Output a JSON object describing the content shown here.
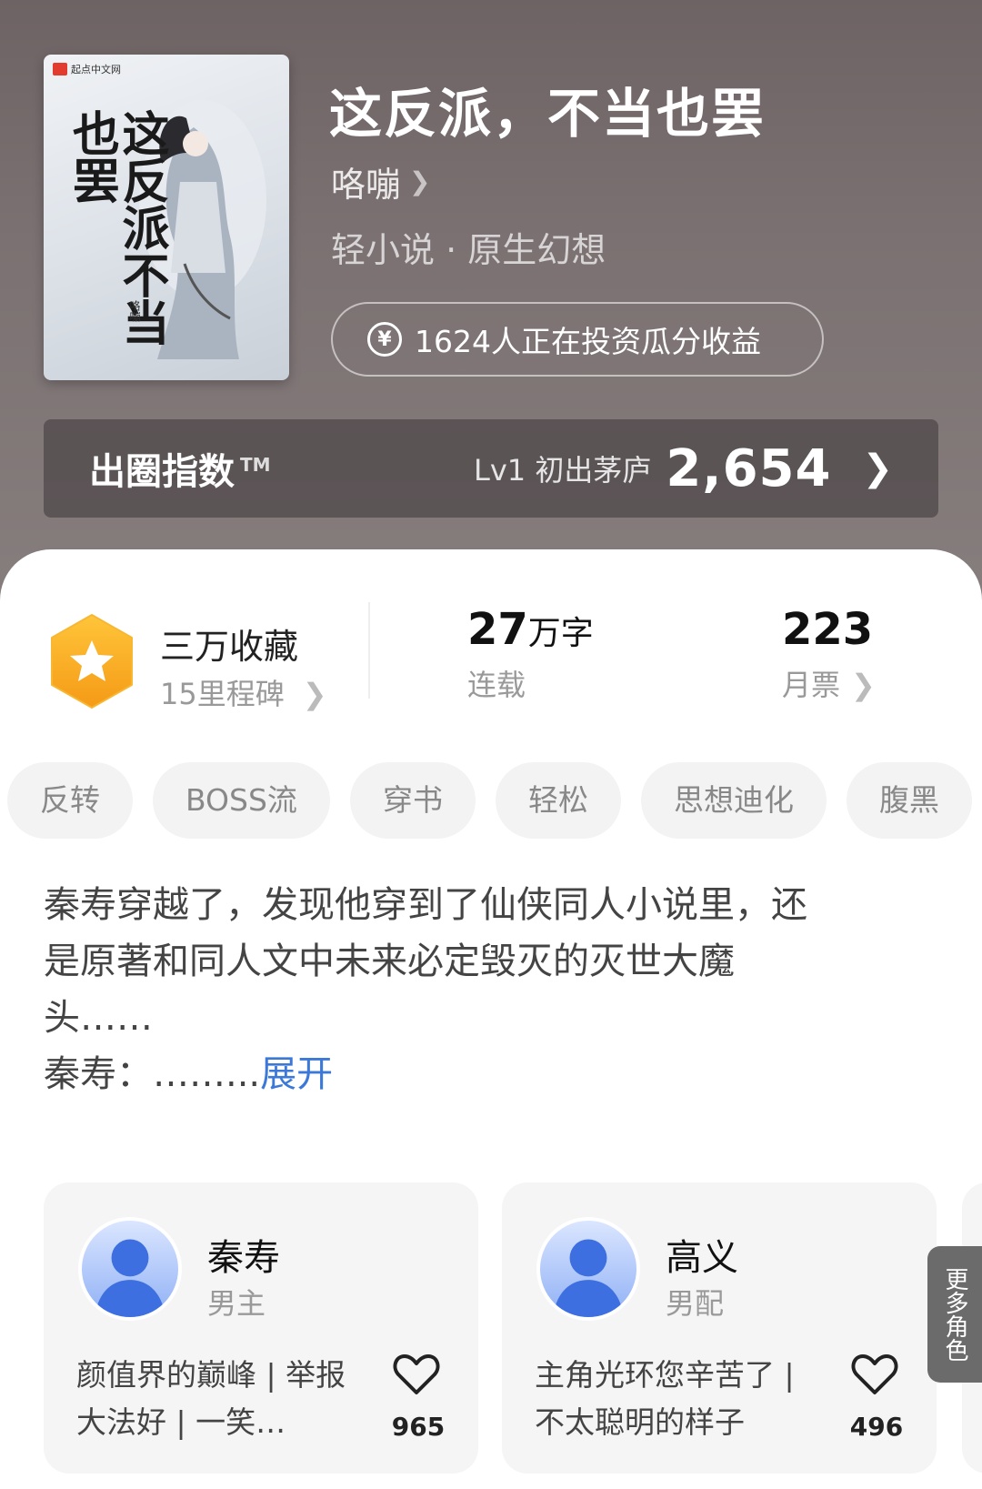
{
  "book": {
    "title": "这反派，不当也罢",
    "author": "咯嘣",
    "genre": "轻小说 · 原生幻想",
    "invest_text": "1624人正在投资瓜分收益",
    "cover": {
      "publisher": "起点中文网",
      "title_art": "这反派不当也罢",
      "author_mark": "咯嘣"
    }
  },
  "index_bar": {
    "label": "出圈指数",
    "tm": "TM",
    "level": "Lv1 初出茅庐",
    "score": "2,654"
  },
  "stats": {
    "collect_main": "三万收藏",
    "collect_sub": "15里程碑",
    "words_num": "27",
    "words_unit": "万字",
    "words_sub": "连载",
    "tickets_num": "223",
    "tickets_sub": "月票"
  },
  "tags": [
    "反转",
    "BOSS流",
    "穿书",
    "轻松",
    "思想迪化",
    "腹黑"
  ],
  "synopsis": {
    "line1": "秦寿穿越了，发现他穿到了仙侠同人小说里，还",
    "line2": "是原著和同人文中未来必定毁灭的灭世大魔",
    "line3": "头……",
    "line4": "秦寿：……",
    "ellipsis": "...",
    "expand": "展开"
  },
  "characters": [
    {
      "name": "秦寿",
      "role": "男主",
      "desc": "颜值界的巅峰 | 举报大法好 | 一笑…",
      "likes": "965"
    },
    {
      "name": "高义",
      "role": "男配",
      "desc": "主角光环您辛苦了 | 不太聪明的样子",
      "likes": "496"
    }
  ],
  "more_roles": "更多角色",
  "colors": {
    "header_bg": "#7a7071",
    "accent_blue": "#3b78d8",
    "badge_orange": "#f7a21b"
  },
  "icons": [
    "yen-icon",
    "chevron-right-icon",
    "star-badge-icon",
    "heart-icon",
    "avatar-icon"
  ]
}
